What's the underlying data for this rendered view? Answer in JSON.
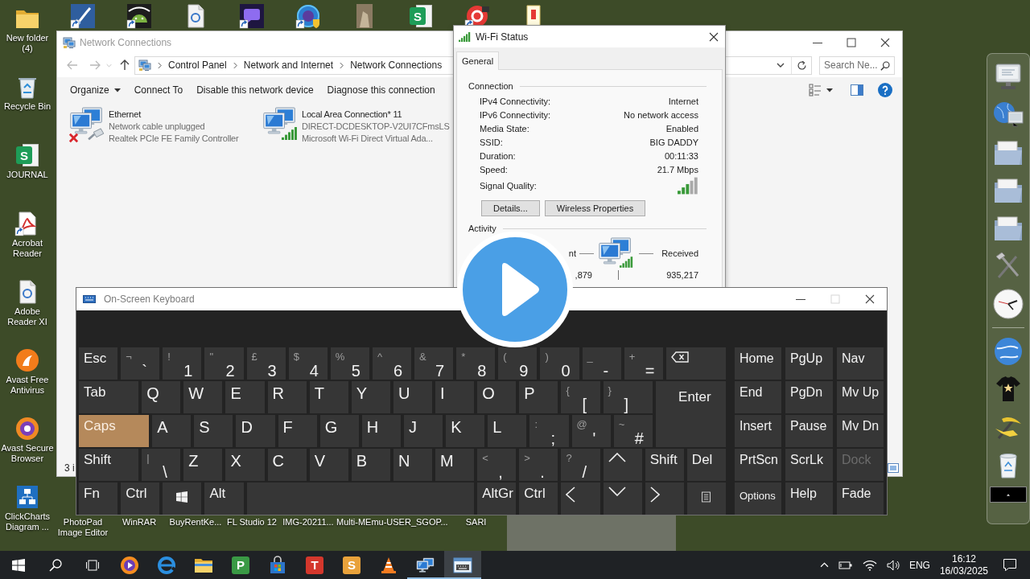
{
  "desktop": {
    "top_row": [
      {
        "kind": "brush"
      },
      {
        "kind": "robot"
      },
      {
        "kind": "document"
      },
      {
        "kind": "chat"
      },
      {
        "kind": "ring"
      },
      {
        "kind": "photo"
      },
      {
        "kind": "sheet",
        "glyph": "S"
      },
      {
        "kind": "target"
      },
      {
        "kind": "note"
      }
    ],
    "left_column": [
      {
        "label": "New folder\n(4)",
        "kind": "folder"
      },
      {
        "label": "Recycle Bin",
        "kind": "bin"
      },
      {
        "label": "JOURNAL",
        "kind": "sheet",
        "glyph": "S"
      },
      {
        "label": "Acrobat\nReader",
        "kind": "pdf"
      },
      {
        "label": "Adobe\nReader XI",
        "kind": "document"
      },
      {
        "label": "Avast Free\nAntivirus",
        "kind": "avast"
      },
      {
        "label": "Avast Secure\nBrowser",
        "kind": "secure"
      },
      {
        "label": "ClickCharts\nDiagram ...",
        "kind": "diagram"
      }
    ],
    "bottom_row": [
      {
        "label": "PhotoPad\nImage Editor"
      },
      {
        "label": "WinRAR"
      },
      {
        "label": "BuyRentKe..."
      },
      {
        "label": "FL Studio 12"
      },
      {
        "label": "IMG-20211..."
      },
      {
        "label": "Multi-MEmu-USER_SGOP..."
      },
      {
        "label": "SARI"
      }
    ]
  },
  "explorer": {
    "title": "Network Connections",
    "breadcrumbs": [
      "Control Panel",
      "Network and Internet",
      "Network Connections"
    ],
    "search": {
      "placeholder": "Search Ne..."
    },
    "toolbar": [
      {
        "label": "Organize",
        "kind": "menu"
      },
      {
        "label": "Connect To",
        "kind": "button"
      },
      {
        "label": "Disable this network device",
        "kind": "button"
      },
      {
        "label": "Diagnose this connection",
        "kind": "button"
      }
    ],
    "connections": [
      {
        "name": "Ethernet",
        "status": "Network cable unplugged",
        "adapter": "Realtek PCIe FE Family Controller",
        "kind": "wired",
        "connected": false
      },
      {
        "name": "Local Area Connection* 11",
        "status": "DIRECT-DCDESKTOP-V2UI7CFmsLS",
        "adapter": "Microsoft Wi-Fi Direct Virtual Ada...",
        "kind": "wireless",
        "connected": true
      }
    ],
    "status_bar": "3 i"
  },
  "wifi_status": {
    "title": "Wi-Fi Status",
    "tabs": [
      {
        "label": "General",
        "selected": true
      }
    ],
    "connection": {
      "title": "Connection",
      "rows": [
        {
          "label": "IPv4 Connectivity:",
          "value": "Internet"
        },
        {
          "label": "IPv6 Connectivity:",
          "value": "No network access"
        },
        {
          "label": "Media State:",
          "value": "Enabled"
        },
        {
          "label": "SSID:",
          "value": "BIG DADDY"
        },
        {
          "label": "Duration:",
          "value": "00:11:33"
        },
        {
          "label": "Speed:",
          "value": "21.7 Mbps"
        }
      ],
      "signal_label": "Signal Quality:"
    },
    "buttons": [
      "Details...",
      "Wireless Properties"
    ],
    "activity": {
      "title": "Activity",
      "left_label": "nt",
      "right_label": "Received",
      "left_value": ",879",
      "right_value": "935,217"
    }
  },
  "keyboard": {
    "title": "On-Screen Keyboard",
    "maximize_disabled": true,
    "rows": [
      {
        "keys": [
          {
            "kind": "key",
            "label": "Esc",
            "on": false
          },
          {
            "kind": "key",
            "shift": "¬",
            "label": "`",
            "on": false
          },
          {
            "kind": "key",
            "shift": "!",
            "label": "1",
            "on": false
          },
          {
            "kind": "key",
            "shift": "\"",
            "label": "2",
            "on": false
          },
          {
            "kind": "key",
            "shift": "£",
            "label": "3",
            "on": false
          },
          {
            "kind": "key",
            "shift": "$",
            "label": "4",
            "on": false
          },
          {
            "kind": "key",
            "shift": "%",
            "label": "5",
            "on": false
          },
          {
            "kind": "key",
            "shift": "^",
            "label": "6",
            "on": false
          },
          {
            "kind": "key",
            "shift": "&",
            "label": "7",
            "on": false
          },
          {
            "kind": "key",
            "shift": "*",
            "label": "8",
            "on": false
          },
          {
            "kind": "key",
            "shift": "(",
            "label": "9",
            "on": false
          },
          {
            "kind": "key",
            "shift": ")",
            "label": "0",
            "on": false
          },
          {
            "kind": "key",
            "shift": "_",
            "label": "-",
            "on": false
          },
          {
            "kind": "key",
            "shift": "+",
            "label": "=",
            "on": false
          },
          {
            "kind": "backspace",
            "on": false
          }
        ]
      },
      {
        "keys": [
          {
            "kind": "key",
            "label": "Tab",
            "on": false
          },
          {
            "kind": "key",
            "label": "Q",
            "on": false
          },
          {
            "kind": "key",
            "label": "W",
            "on": false
          },
          {
            "kind": "key",
            "label": "E",
            "on": false
          },
          {
            "kind": "key",
            "label": "R",
            "on": false
          },
          {
            "kind": "key",
            "label": "T",
            "on": false
          },
          {
            "kind": "key",
            "label": "Y",
            "on": false
          },
          {
            "kind": "key",
            "label": "U",
            "on": false
          },
          {
            "kind": "key",
            "label": "I",
            "on": false
          },
          {
            "kind": "key",
            "label": "O",
            "on": false
          },
          {
            "kind": "key",
            "label": "P",
            "on": false
          },
          {
            "kind": "key",
            "shift": "{",
            "label": "[",
            "on": false
          },
          {
            "kind": "key",
            "shift": "}",
            "label": "]",
            "on": false
          },
          {
            "kind": "key",
            "label": "Enter",
            "on": false
          }
        ]
      },
      {
        "keys": [
          {
            "kind": "key",
            "label": "Caps",
            "on": true
          },
          {
            "kind": "key",
            "label": "A",
            "on": false
          },
          {
            "kind": "key",
            "label": "S",
            "on": false
          },
          {
            "kind": "key",
            "label": "D",
            "on": false
          },
          {
            "kind": "key",
            "label": "F",
            "on": false
          },
          {
            "kind": "key",
            "label": "G",
            "on": false
          },
          {
            "kind": "key",
            "label": "H",
            "on": false
          },
          {
            "kind": "key",
            "label": "J",
            "on": false
          },
          {
            "kind": "key",
            "label": "K",
            "on": false
          },
          {
            "kind": "key",
            "label": "L",
            "on": false
          },
          {
            "kind": "key",
            "shift": ":",
            "label": ";",
            "on": false
          },
          {
            "kind": "key",
            "shift": "@",
            "label": "'",
            "on": false
          },
          {
            "kind": "key",
            "shift": "~",
            "label": "#",
            "on": false
          }
        ]
      },
      {
        "keys": [
          {
            "kind": "key",
            "label": "Shift",
            "on": false
          },
          {
            "kind": "key",
            "shift": "|",
            "label": "\\",
            "on": false
          },
          {
            "kind": "key",
            "label": "Z",
            "on": false
          },
          {
            "kind": "key",
            "label": "X",
            "on": false
          },
          {
            "kind": "key",
            "label": "C",
            "on": false
          },
          {
            "kind": "key",
            "label": "V",
            "on": false
          },
          {
            "kind": "key",
            "label": "B",
            "on": false
          },
          {
            "kind": "key",
            "label": "N",
            "on": false
          },
          {
            "kind": "key",
            "label": "M",
            "on": false
          },
          {
            "kind": "key",
            "shift": "<",
            "label": ",",
            "on": false
          },
          {
            "kind": "key",
            "shift": ">",
            "label": ".",
            "on": false
          },
          {
            "kind": "key",
            "shift": "?",
            "label": "/",
            "on": false
          },
          {
            "kind": "up",
            "on": false
          },
          {
            "kind": "key",
            "label": "Shift",
            "on": false
          },
          {
            "kind": "key",
            "label": "Del",
            "on": false
          }
        ]
      },
      {
        "keys": [
          {
            "kind": "key",
            "label": "Fn",
            "on": false
          },
          {
            "kind": "key",
            "label": "Ctrl",
            "on": false
          },
          {
            "kind": "windows",
            "on": false
          },
          {
            "kind": "key",
            "label": "Alt",
            "on": false
          },
          {
            "kind": "space",
            "on": false
          },
          {
            "kind": "key",
            "label": "AltGr",
            "on": false
          },
          {
            "kind": "key",
            "label": "Ctrl",
            "on": false
          },
          {
            "kind": "left",
            "on": false
          },
          {
            "kind": "down",
            "on": false
          },
          {
            "kind": "right",
            "on": false
          },
          {
            "kind": "menu",
            "on": false
          }
        ]
      }
    ],
    "nav_keys": [
      {
        "label": "Home",
        "disabled": false
      },
      {
        "label": "PgUp",
        "disabled": false
      },
      {
        "label": "Nav",
        "disabled": false
      },
      {
        "label": "End",
        "disabled": false
      },
      {
        "label": "PgDn",
        "disabled": false
      },
      {
        "label": "Mv Up",
        "disabled": false
      },
      {
        "label": "Insert",
        "disabled": false
      },
      {
        "label": "Pause",
        "disabled": false
      },
      {
        "label": "Mv Dn",
        "disabled": false
      },
      {
        "label": "PrtScn",
        "disabled": false
      },
      {
        "label": "ScrLk",
        "disabled": false
      },
      {
        "label": "Dock",
        "disabled": true
      },
      {
        "label": "Options",
        "disabled": false
      },
      {
        "label": "Help",
        "disabled": false
      },
      {
        "label": "Fade",
        "disabled": false
      }
    ]
  },
  "taskbar": {
    "apps": [
      {
        "kind": "round",
        "open": false,
        "selected": false
      },
      {
        "kind": "edge",
        "open": false,
        "selected": false
      },
      {
        "kind": "folder",
        "open": false,
        "selected": false
      },
      {
        "kind": "tile",
        "glyph": "P",
        "color": "#3a9a45",
        "open": false,
        "selected": false
      },
      {
        "kind": "store",
        "open": false,
        "selected": false
      },
      {
        "kind": "tile",
        "glyph": "T",
        "color": "#d4372c",
        "open": false,
        "selected": false
      },
      {
        "kind": "tile",
        "glyph": "S",
        "color": "#e9a23b",
        "open": false,
        "selected": false
      },
      {
        "kind": "cone",
        "open": false,
        "selected": false
      },
      {
        "kind": "network",
        "open": true,
        "selected": false
      },
      {
        "kind": "keyboard",
        "open": true,
        "selected": true
      }
    ],
    "language": "ENG",
    "time": "16:12",
    "date": "16/03/2025"
  }
}
